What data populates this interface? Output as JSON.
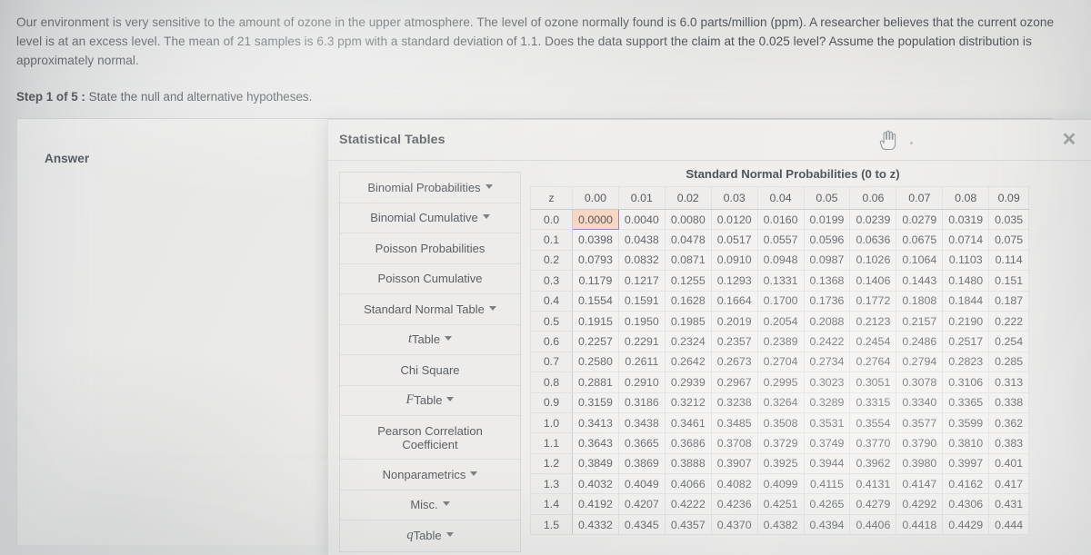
{
  "question": {
    "paragraph": "Our environment is very sensitive to the amount of ozone in the upper atmosphere.  The level of ozone normally found is 6.0 parts/million (ppm).  A researcher believes that the current ozone level is at an excess level.  The mean of 21 samples is 6.3 ppm with a standard deviation of 1.1.  Does the data support the claim at the 0.025 level?  Assume the population distribution is approximately normal.",
    "step_label": "Step 1 of 5 :",
    "step_text": "State the null and alternative hypotheses."
  },
  "answer": {
    "label": "Answer"
  },
  "modal": {
    "title": "Statistical Tables",
    "close_icon": "close-icon",
    "close_glyph": "✕",
    "cursor_icon": "pointing-hand-cursor"
  },
  "nav": {
    "items": [
      {
        "label": "Binomial Probabilities",
        "caret": true,
        "tall": false
      },
      {
        "label": "Binomial Cumulative",
        "caret": true,
        "tall": false
      },
      {
        "label": "Poisson Probabilities",
        "caret": false,
        "tall": false
      },
      {
        "label": "Poisson Cumulative",
        "caret": false,
        "tall": false
      },
      {
        "label": "Standard Normal Table",
        "caret": true,
        "tall": false
      },
      {
        "label": "Table",
        "italic": "t",
        "caret": true,
        "tall": false
      },
      {
        "label": "Chi Square",
        "caret": false,
        "tall": false
      },
      {
        "label": "Table",
        "italic": "F",
        "caret": true,
        "tall": false
      },
      {
        "label": "Pearson Correlation Coefficient",
        "caret": false,
        "tall": true
      },
      {
        "label": "Nonparametrics",
        "caret": true,
        "tall": false
      },
      {
        "label": "Misc.",
        "caret": true,
        "tall": false
      },
      {
        "label": "Table",
        "italic": "q",
        "caret": true,
        "tall": false
      }
    ]
  },
  "z_table": {
    "title": "Standard Normal Probabilities (0 to z)",
    "corner_label": "z",
    "columns": [
      "0.00",
      "0.01",
      "0.02",
      "0.03",
      "0.04",
      "0.05",
      "0.06",
      "0.07",
      "0.08",
      "0.09"
    ],
    "highlight": {
      "row": 0,
      "col": 0
    },
    "rows": [
      {
        "z": "0.0",
        "values": [
          "0.0000",
          "0.0040",
          "0.0080",
          "0.0120",
          "0.0160",
          "0.0199",
          "0.0239",
          "0.0279",
          "0.0319",
          "0.035"
        ]
      },
      {
        "z": "0.1",
        "values": [
          "0.0398",
          "0.0438",
          "0.0478",
          "0.0517",
          "0.0557",
          "0.0596",
          "0.0636",
          "0.0675",
          "0.0714",
          "0.075"
        ]
      },
      {
        "z": "0.2",
        "values": [
          "0.0793",
          "0.0832",
          "0.0871",
          "0.0910",
          "0.0948",
          "0.0987",
          "0.1026",
          "0.1064",
          "0.1103",
          "0.114"
        ]
      },
      {
        "z": "0.3",
        "values": [
          "0.1179",
          "0.1217",
          "0.1255",
          "0.1293",
          "0.1331",
          "0.1368",
          "0.1406",
          "0.1443",
          "0.1480",
          "0.151"
        ]
      },
      {
        "z": "0.4",
        "values": [
          "0.1554",
          "0.1591",
          "0.1628",
          "0.1664",
          "0.1700",
          "0.1736",
          "0.1772",
          "0.1808",
          "0.1844",
          "0.187"
        ]
      },
      {
        "z": "0.5",
        "values": [
          "0.1915",
          "0.1950",
          "0.1985",
          "0.2019",
          "0.2054",
          "0.2088",
          "0.2123",
          "0.2157",
          "0.2190",
          "0.222"
        ]
      },
      {
        "z": "0.6",
        "values": [
          "0.2257",
          "0.2291",
          "0.2324",
          "0.2357",
          "0.2389",
          "0.2422",
          "0.2454",
          "0.2486",
          "0.2517",
          "0.254"
        ]
      },
      {
        "z": "0.7",
        "values": [
          "0.2580",
          "0.2611",
          "0.2642",
          "0.2673",
          "0.2704",
          "0.2734",
          "0.2764",
          "0.2794",
          "0.2823",
          "0.285"
        ]
      },
      {
        "z": "0.8",
        "values": [
          "0.2881",
          "0.2910",
          "0.2939",
          "0.2967",
          "0.2995",
          "0.3023",
          "0.3051",
          "0.3078",
          "0.3106",
          "0.313"
        ]
      },
      {
        "z": "0.9",
        "values": [
          "0.3159",
          "0.3186",
          "0.3212",
          "0.3238",
          "0.3264",
          "0.3289",
          "0.3315",
          "0.3340",
          "0.3365",
          "0.338"
        ]
      },
      {
        "z": "1.0",
        "values": [
          "0.3413",
          "0.3438",
          "0.3461",
          "0.3485",
          "0.3508",
          "0.3531",
          "0.3554",
          "0.3577",
          "0.3599",
          "0.362"
        ]
      },
      {
        "z": "1.1",
        "values": [
          "0.3643",
          "0.3665",
          "0.3686",
          "0.3708",
          "0.3729",
          "0.3749",
          "0.3770",
          "0.3790",
          "0.3810",
          "0.383"
        ]
      },
      {
        "z": "1.2",
        "values": [
          "0.3849",
          "0.3869",
          "0.3888",
          "0.3907",
          "0.3925",
          "0.3944",
          "0.3962",
          "0.3980",
          "0.3997",
          "0.401"
        ]
      },
      {
        "z": "1.3",
        "values": [
          "0.4032",
          "0.4049",
          "0.4066",
          "0.4082",
          "0.4099",
          "0.4115",
          "0.4131",
          "0.4147",
          "0.4162",
          "0.417"
        ]
      },
      {
        "z": "1.4",
        "values": [
          "0.4192",
          "0.4207",
          "0.4222",
          "0.4236",
          "0.4251",
          "0.4265",
          "0.4279",
          "0.4292",
          "0.4306",
          "0.431"
        ]
      },
      {
        "z": "1.5",
        "values": [
          "0.4332",
          "0.4345",
          "0.4357",
          "0.4370",
          "0.4382",
          "0.4394",
          "0.4406",
          "0.4418",
          "0.4429",
          "0.444"
        ]
      }
    ]
  },
  "colors": {
    "highlight_bg": "#f8d6c2",
    "highlight_border": "#8d8fc4",
    "text": "#5b6066",
    "panel_bg": "#eceae8"
  }
}
